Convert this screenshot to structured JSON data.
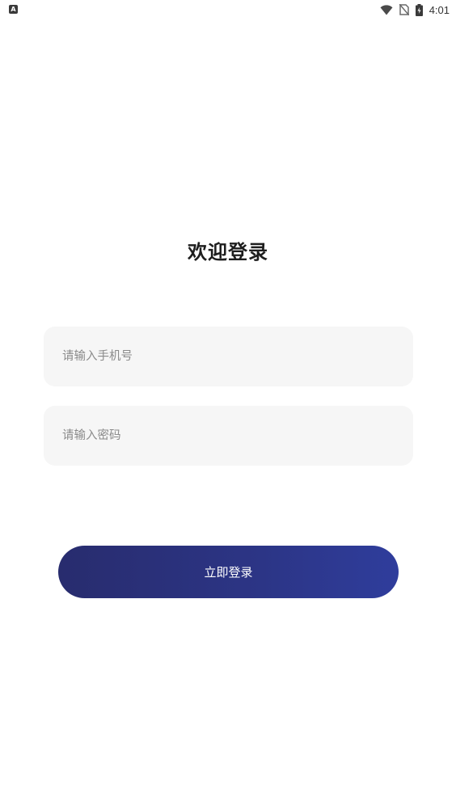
{
  "status_bar": {
    "left_icon": "A",
    "time": "4:01",
    "icons": [
      "wifi-icon",
      "no-sim-icon",
      "battery-icon"
    ]
  },
  "login": {
    "title": "欢迎登录",
    "phone_placeholder": "请输入手机号",
    "password_placeholder": "请输入密码",
    "submit_label": "立即登录"
  },
  "colors": {
    "button_gradient_start": "#282c6e",
    "button_gradient_end": "#2f3d9c",
    "field_background": "#f6f6f6",
    "placeholder": "#8a8a8a",
    "title": "#1e1e1e"
  }
}
